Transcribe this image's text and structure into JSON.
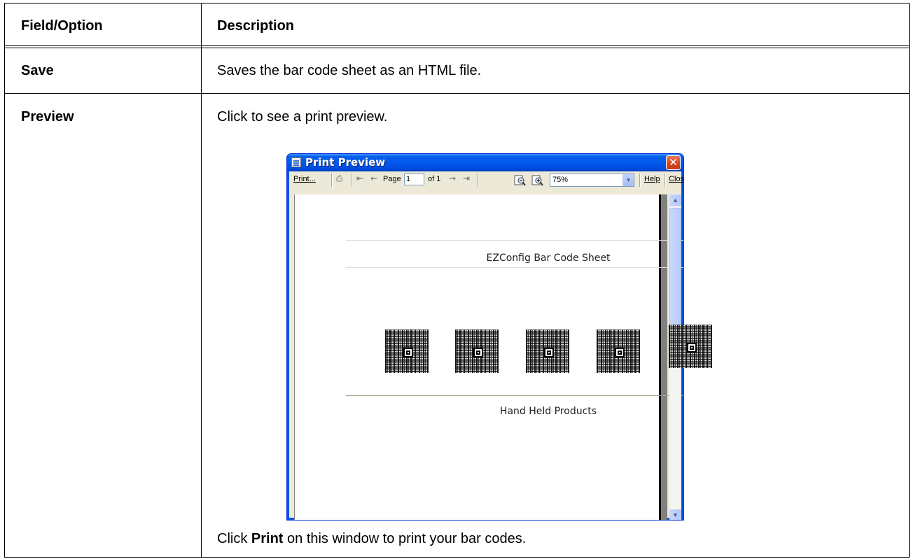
{
  "table": {
    "headers": [
      "Field/Option",
      "Description"
    ],
    "rows": [
      {
        "field": "Save",
        "description": "Saves the bar code sheet as an HTML file."
      },
      {
        "field": "Preview",
        "description": "Click to see a print preview.",
        "note_prefix": "Click ",
        "note_bold": "Print",
        "note_suffix": " on this window to print your bar codes."
      }
    ]
  },
  "window": {
    "title": "Print Preview",
    "close_glyph": "✕",
    "toolbar": {
      "print_label": "Print...",
      "page_label": "Page",
      "page_value": "1",
      "of_label": "of 1",
      "zoom_value": "75%",
      "help_label": "Help",
      "close_label": "Close"
    },
    "paper": {
      "title": "EZConfig Bar Code Sheet",
      "footer": "Hand Held Products",
      "barcode_count": 5
    }
  }
}
